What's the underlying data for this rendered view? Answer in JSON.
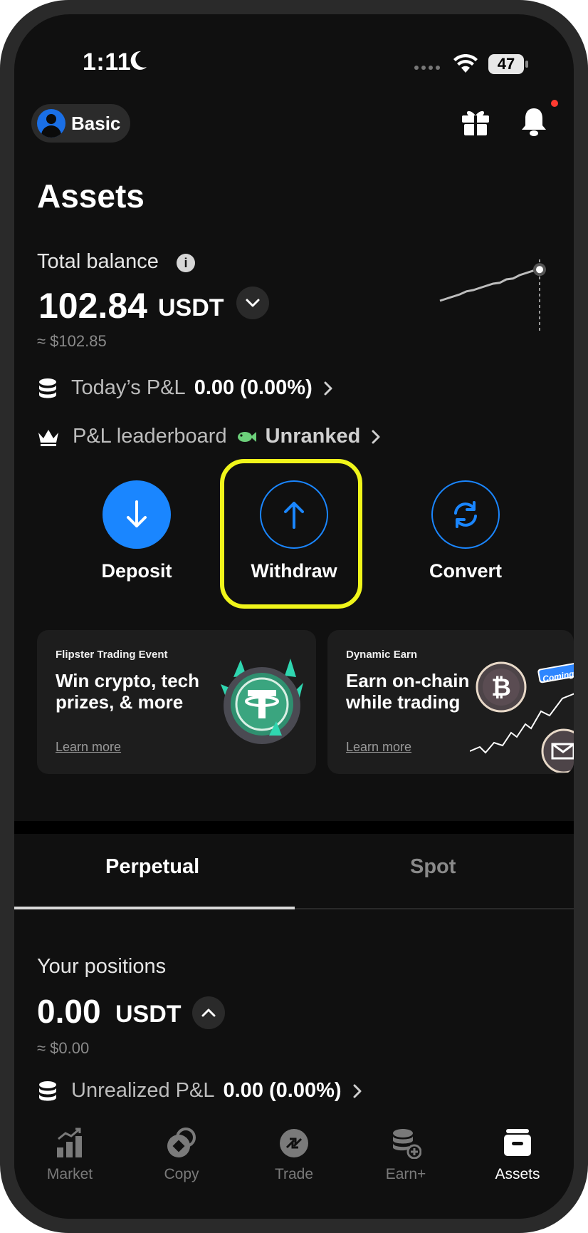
{
  "status_bar": {
    "time": "1:11",
    "battery": "47"
  },
  "header": {
    "plan_label": "Basic",
    "title": "Assets"
  },
  "balance": {
    "label": "Total balance",
    "value": "102.84",
    "unit": "USDT",
    "approx": "≈ $102.85",
    "sparkline": [
      0.2,
      0.25,
      0.3,
      0.35,
      0.42,
      0.45,
      0.5,
      0.55,
      0.6,
      0.62,
      0.7,
      0.72,
      0.8,
      0.85,
      0.9,
      0.93
    ]
  },
  "pnl": {
    "label": "Today’s P&L",
    "value": "0.00 (0.00%)"
  },
  "leaderboard": {
    "label": "P&L leaderboard",
    "status": "Unranked"
  },
  "actions": [
    {
      "label": "Deposit"
    },
    {
      "label": "Withdraw"
    },
    {
      "label": "Convert"
    }
  ],
  "cards": [
    {
      "kicker": "Flipster Trading Event",
      "title": "Win crypto, tech prizes, & more",
      "link": "Learn more"
    },
    {
      "kicker": "Dynamic Earn",
      "title": "Earn on-chain while trading",
      "link": "Learn more",
      "badge": "Coming"
    }
  ],
  "tabs": [
    {
      "label": "Perpetual"
    },
    {
      "label": "Spot"
    }
  ],
  "positions": {
    "label": "Your positions",
    "value": "0.00",
    "unit": "USDT",
    "approx": "≈ $0.00",
    "unrealized_label": "Unrealized P&L",
    "unrealized_value": "0.00 (0.00%)"
  },
  "nav": [
    {
      "label": "Market",
      "icon": "market-icon"
    },
    {
      "label": "Copy",
      "icon": "copy-icon"
    },
    {
      "label": "Trade",
      "icon": "trade-icon"
    },
    {
      "label": "Earn+",
      "icon": "earn-icon"
    },
    {
      "label": "Assets",
      "icon": "assets-icon",
      "active": true
    }
  ],
  "colors": {
    "accent": "#1a86ff",
    "highlight": "#f0f51a",
    "notification": "#ff3b30"
  }
}
